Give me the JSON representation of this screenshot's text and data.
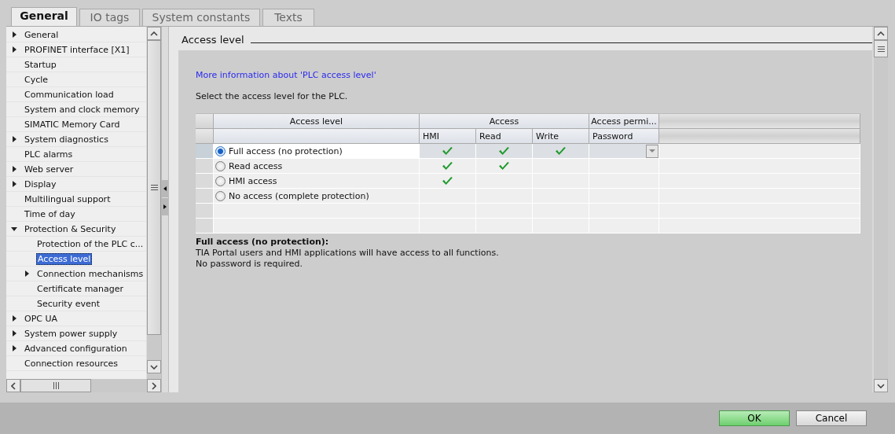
{
  "tabs": [
    {
      "label": "General",
      "selected": true
    },
    {
      "label": "IO tags",
      "selected": false
    },
    {
      "label": "System constants",
      "selected": false
    },
    {
      "label": "Texts",
      "selected": false
    }
  ],
  "tree": [
    {
      "label": "General",
      "expanded": false,
      "selected": false
    },
    {
      "label": "PROFINET interface [X1]",
      "expanded": false,
      "selected": false
    },
    {
      "label": "Startup",
      "selected": false
    },
    {
      "label": "Cycle",
      "selected": false
    },
    {
      "label": "Communication load",
      "selected": false
    },
    {
      "label": "System and clock memory",
      "selected": false
    },
    {
      "label": "SIMATIC Memory Card",
      "selected": false
    },
    {
      "label": "System diagnostics",
      "expanded": false,
      "selected": false
    },
    {
      "label": "PLC alarms",
      "selected": false
    },
    {
      "label": "Web server",
      "expanded": false,
      "selected": false
    },
    {
      "label": "Display",
      "expanded": false,
      "selected": false
    },
    {
      "label": "Multilingual support",
      "selected": false
    },
    {
      "label": "Time of day",
      "selected": false
    },
    {
      "label": "Protection & Security",
      "expanded": true,
      "selected": false,
      "children": [
        {
          "label": "Protection of the PLC c...",
          "selected": false
        },
        {
          "label": "Access level",
          "selected": true
        },
        {
          "label": "Connection mechanisms",
          "expanded": false,
          "selected": false
        },
        {
          "label": "Certificate manager",
          "selected": false
        },
        {
          "label": "Security event",
          "selected": false
        }
      ]
    },
    {
      "label": "OPC UA",
      "expanded": false,
      "selected": false
    },
    {
      "label": "System power supply",
      "expanded": false,
      "selected": false
    },
    {
      "label": "Advanced configuration",
      "expanded": false,
      "selected": false
    },
    {
      "label": "Connection resources",
      "selected": false
    }
  ],
  "section": {
    "title": "Access level",
    "link": "More information about 'PLC access level'",
    "instruction": "Select the access level for the PLC."
  },
  "table": {
    "group_headers": [
      "Access level",
      "Access",
      "Access permi..."
    ],
    "columns": [
      "HMI",
      "Read",
      "Write",
      "Password"
    ],
    "rows": [
      {
        "label": "Full access (no protection)",
        "selected": true,
        "hmi": true,
        "read": true,
        "write": true
      },
      {
        "label": "Read access",
        "selected": false,
        "hmi": true,
        "read": true,
        "write": false
      },
      {
        "label": "HMI access",
        "selected": false,
        "hmi": true,
        "read": false,
        "write": false
      },
      {
        "label": "No access (complete protection)",
        "selected": false,
        "hmi": false,
        "read": false,
        "write": false
      }
    ]
  },
  "description": {
    "title": "Full access (no protection):",
    "lines": [
      "TIA Portal users and HMI applications will have access to all functions.",
      "No password is required."
    ]
  },
  "buttons": [
    {
      "label": "OK",
      "kind": "primary"
    },
    {
      "label": "Cancel",
      "kind": "secondary"
    }
  ]
}
